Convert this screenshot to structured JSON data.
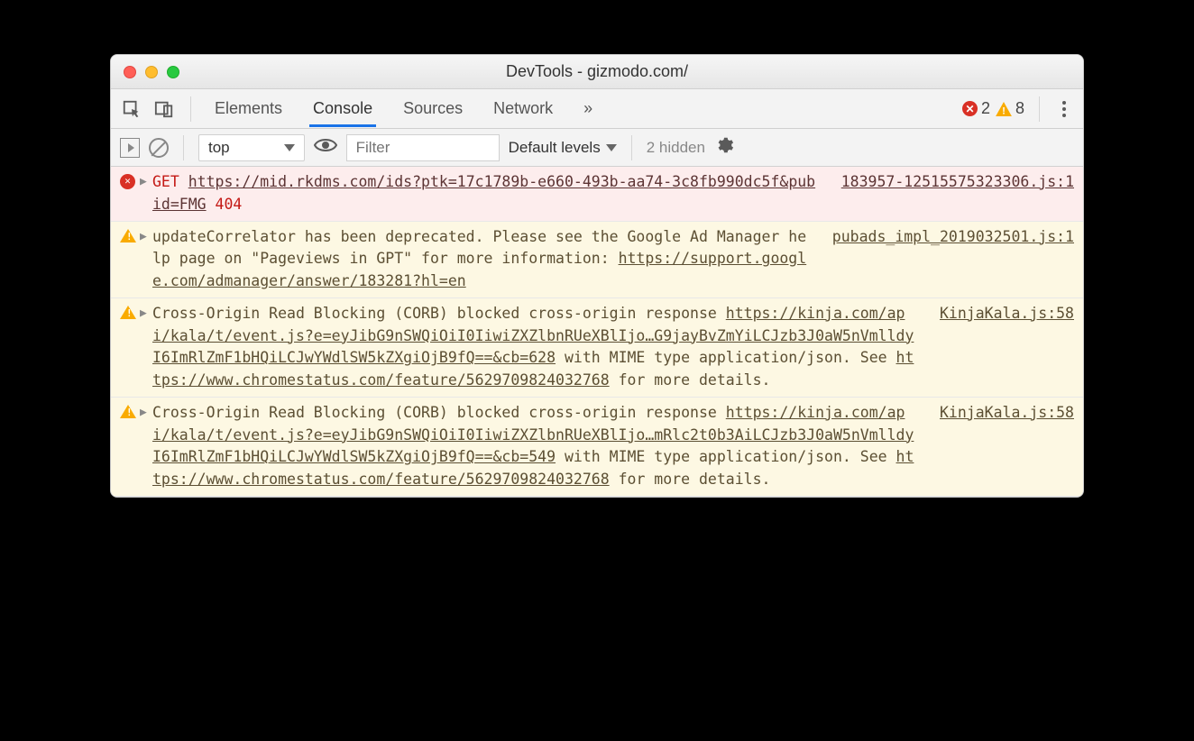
{
  "window": {
    "title": "DevTools - gizmodo.com/"
  },
  "tabs": {
    "items": [
      "Elements",
      "Console",
      "Sources",
      "Network"
    ],
    "active": "Console",
    "overflow": "»"
  },
  "badges": {
    "error_count": "2",
    "warning_count": "8"
  },
  "filterbar": {
    "context": "top",
    "filter_placeholder": "Filter",
    "levels": "Default levels",
    "hidden": "2 hidden"
  },
  "messages": [
    {
      "type": "error",
      "method": "GET",
      "url": "https://mid.rkdms.com/ids?ptk=17c1789b-e660-493b-aa74-3c8fb990dc5f&pubid=FMG",
      "status": "404",
      "source": "183957-12515575323306.js:1"
    },
    {
      "type": "warning",
      "pre": "updateCorrelator has been deprecated. Please see the Google Ad Manager help page on \"Pageviews in GPT\" for more information: ",
      "link": "https://support.google.com/admanager/answer/183281?hl=en",
      "source": "pubads_impl_2019032501.js:1"
    },
    {
      "type": "warning",
      "pre": "Cross-Origin Read Blocking (CORB) blocked cross-origin response ",
      "link": "https://kinja.com/api/kala/t/event.js?e=eyJibG9nSWQiOiI0IiwiZXZlbnRUeXBlIjo…G9jayBvZmYiLCJzb3J0aW5nVmlldyI6ImRlZmF1bHQiLCJwYWdlSW5kZXgiOjB9fQ==&cb=628",
      "mid": " with MIME type application/json. See ",
      "link2": "https://www.chromestatus.com/feature/5629709824032768",
      "post": " for more details.",
      "source": "KinjaKala.js:58"
    },
    {
      "type": "warning",
      "pre": "Cross-Origin Read Blocking (CORB) blocked cross-origin response ",
      "link": "https://kinja.com/api/kala/t/event.js?e=eyJibG9nSWQiOiI0IiwiZXZlbnRUeXBlIjo…mRlc2t0b3AiLCJzb3J0aW5nVmlldyI6ImRlZmF1bHQiLCJwYWdlSW5kZXgiOjB9fQ==&cb=549",
      "mid": " with MIME type application/json. See ",
      "link2": "https://www.chromestatus.com/feature/5629709824032768",
      "post": " for more details.",
      "source": "KinjaKala.js:58"
    }
  ]
}
